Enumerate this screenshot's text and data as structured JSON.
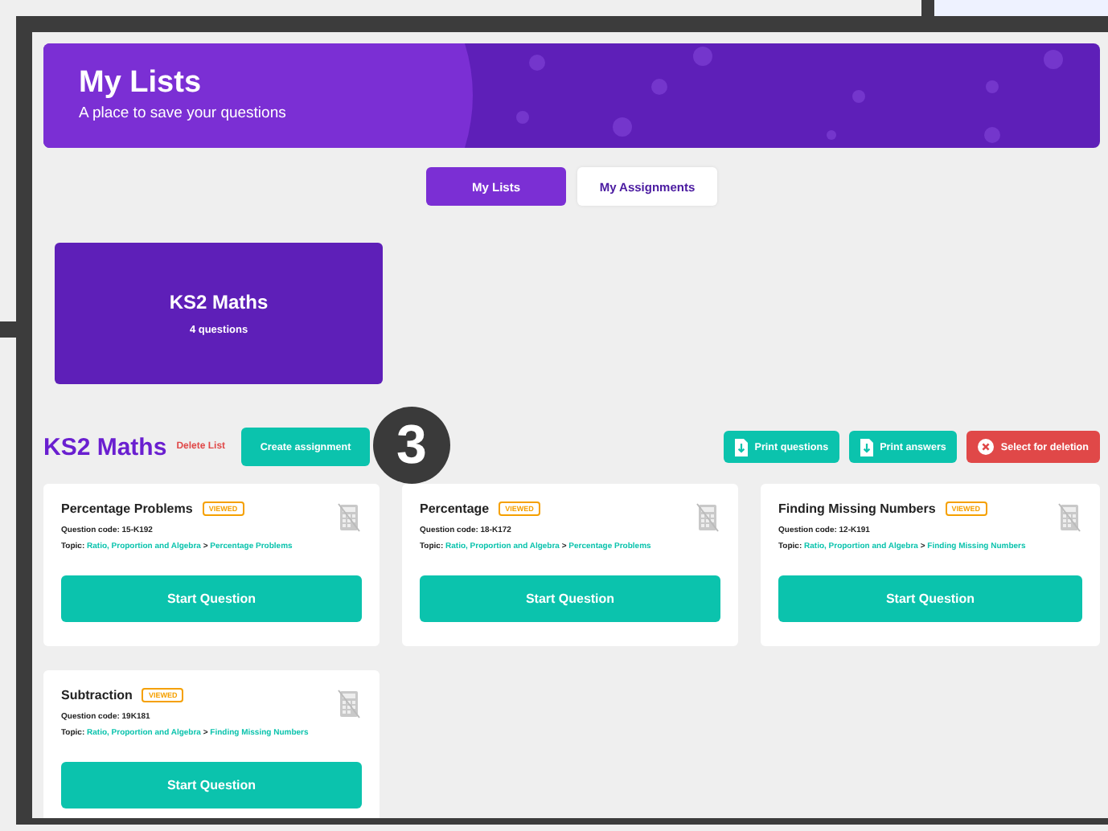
{
  "header": {
    "title": "My Lists",
    "subtitle": "A place to save your questions"
  },
  "tabs": [
    {
      "label": "My Lists",
      "selected": true
    },
    {
      "label": "My Assignments",
      "selected": false
    }
  ],
  "lists": [
    {
      "name": "KS2 Maths",
      "count": "4 questions"
    }
  ],
  "list_section": {
    "title": "KS2 Maths",
    "delete_link": "Delete List",
    "create_button": "Create assignment",
    "actions": [
      {
        "label": "Print questions",
        "kind": "print"
      },
      {
        "label": "Print answers",
        "kind": "print"
      },
      {
        "label": "Select for deletion",
        "kind": "delete"
      }
    ]
  },
  "annotation": "3",
  "questions": [
    {
      "title": "Percentage Problems",
      "badge": "VIEWED",
      "code_label": "Question code:",
      "code": "15-K192",
      "topic_label": "Topic:",
      "topic": "Ratio, Proportion and Algebra",
      "separator": ">",
      "subtopic": "Percentage Problems",
      "button": "Start Question"
    },
    {
      "title": "Percentage",
      "badge": "VIEWED",
      "code_label": "Question code:",
      "code": "18-K172",
      "topic_label": "Topic:",
      "topic": "Ratio, Proportion and Algebra",
      "separator": ">",
      "subtopic": "Percentage Problems",
      "button": "Start Question"
    },
    {
      "title": "Finding Missing Numbers",
      "badge": "VIEWED",
      "code_label": "Question code:",
      "code": "12-K191",
      "topic_label": "Topic:",
      "topic": "Ratio, Proportion and Algebra",
      "separator": ">",
      "subtopic": "Finding Missing Numbers",
      "button": "Start Question"
    },
    {
      "title": "Subtraction",
      "badge": "VIEWED",
      "code_label": "Question code:",
      "code": "19K181",
      "topic_label": "Topic:",
      "topic": "Ratio, Proportion and Algebra",
      "separator": ">",
      "subtopic": "Finding Missing Numbers",
      "button": "Start Question"
    }
  ]
}
